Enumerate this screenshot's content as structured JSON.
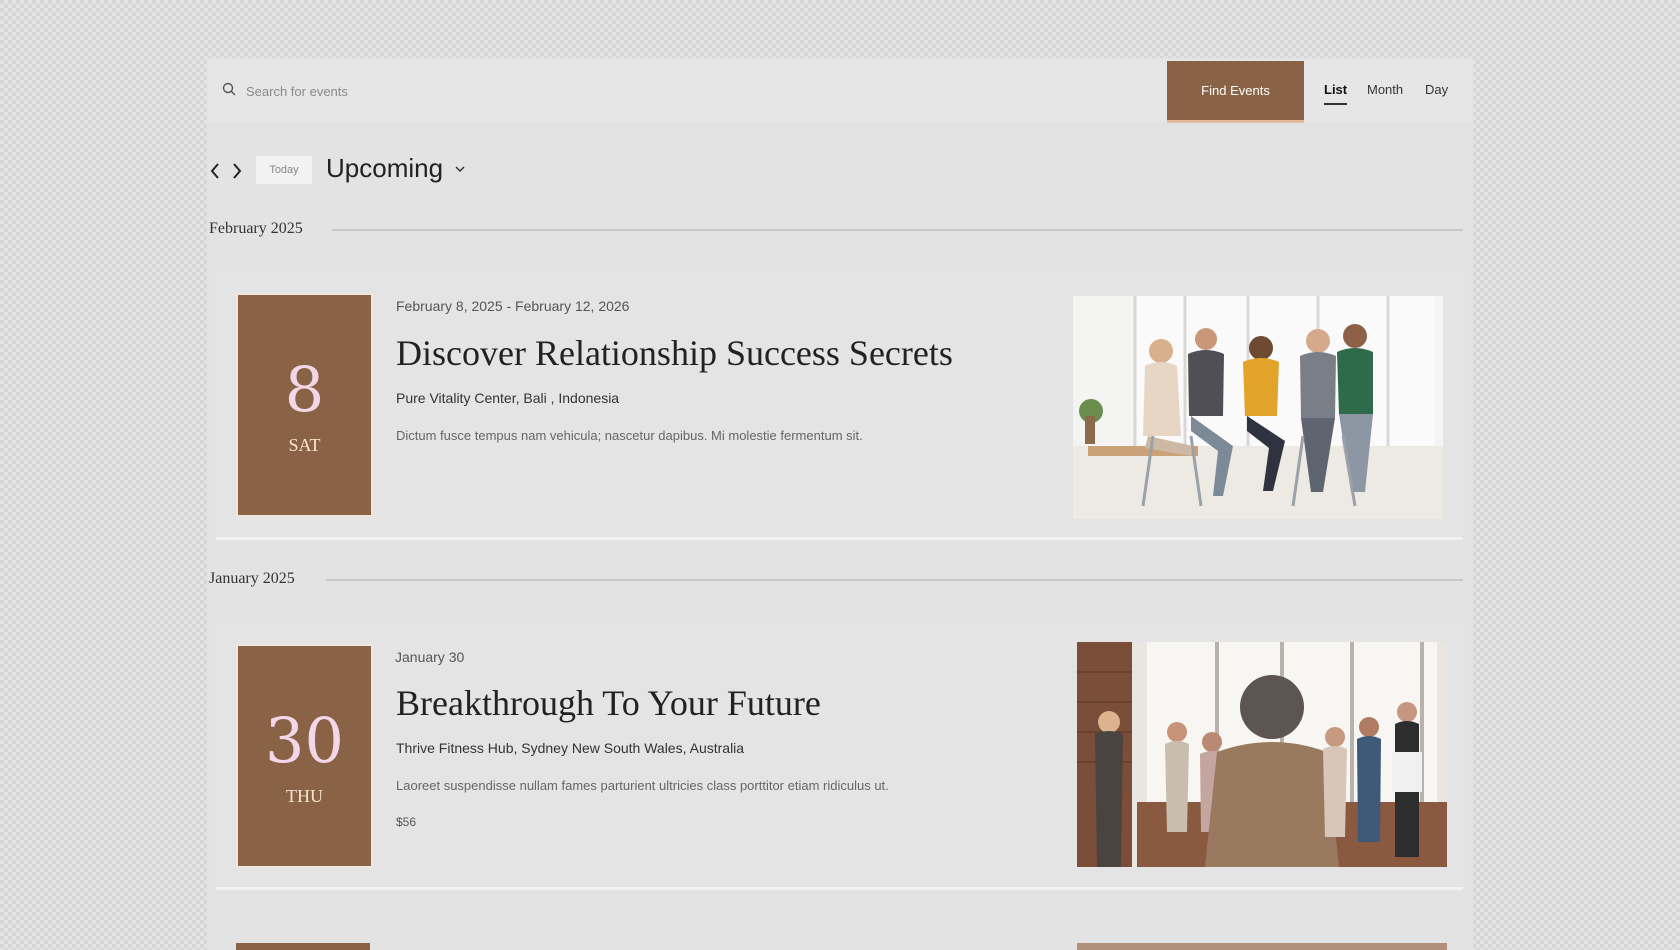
{
  "search": {
    "placeholder": "Search for events",
    "button_label": "Find Events"
  },
  "views": {
    "list": "List",
    "month": "Month",
    "day": "Day",
    "active": "List"
  },
  "nav": {
    "today_label": "Today",
    "range_label": "Upcoming"
  },
  "months": [
    {
      "label": "February 2025",
      "events": [
        {
          "day_num": "8",
          "day_name": "SAT",
          "date_range": "February 8, 2025 - February 12, 2026",
          "title": "Discover Relationship Success Secrets",
          "venue": "Pure Vitality Center, Bali , Indonesia",
          "description": "Dictum fusce tempus nam vehicula; nascetur dapibus. Mi molestie fermentum sit.",
          "price": ""
        }
      ]
    },
    {
      "label": "January 2025",
      "events": [
        {
          "day_num": "30",
          "day_name": "THU",
          "date_range": "January 30",
          "title": "Breakthrough To Your Future",
          "venue": "Thrive Fitness Hub, Sydney New South Wales, Australia",
          "description": "Laoreet suspendisse nullam fames parturient ultricies class porttitor etiam ridiculus ut.",
          "price": "$56"
        }
      ]
    }
  ],
  "colors": {
    "accent": "#8a6246",
    "date_number": "#f3d7e9",
    "date_day": "#fbe5cf"
  }
}
